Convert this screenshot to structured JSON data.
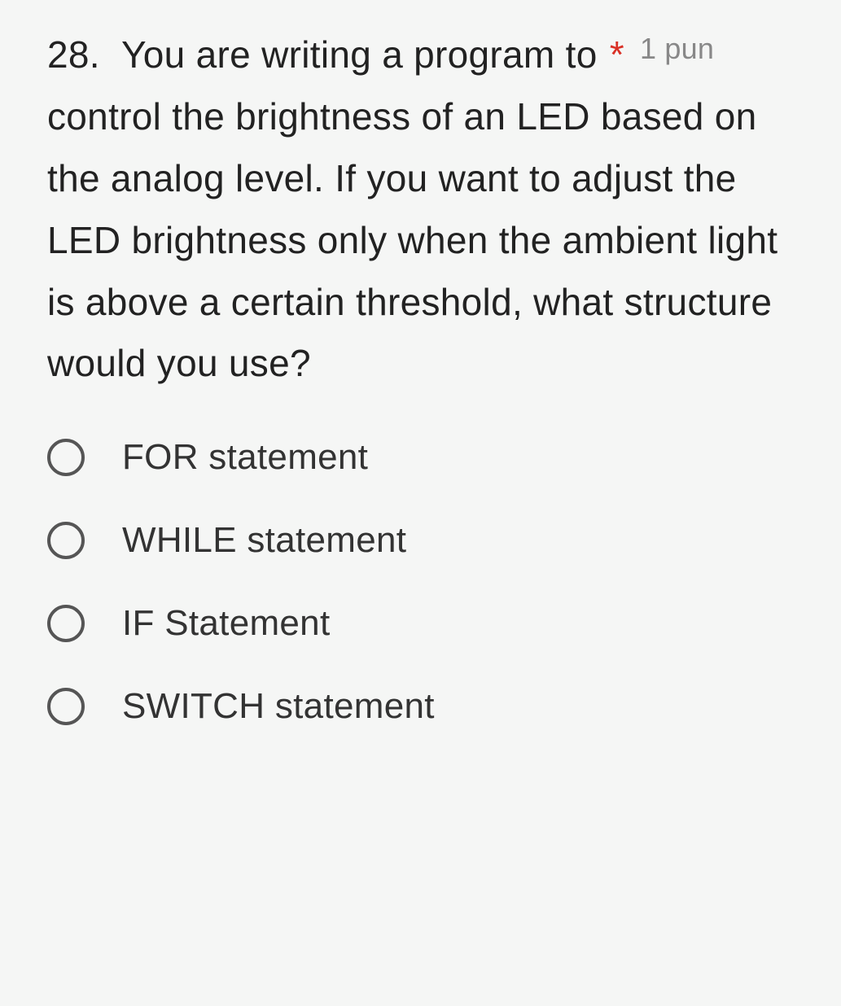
{
  "question": {
    "number": "28.",
    "text_line1": "You are writing a program to",
    "text_rest": "control the brightness of an LED based on the analog level. If you want to adjust the LED brightness only when the ambient light is above a certain threshold, what structure would you use?",
    "required_mark": "*",
    "points_label": "1 pun"
  },
  "options": [
    {
      "label": "FOR statement"
    },
    {
      "label": "WHILE statement"
    },
    {
      "label": "IF Statement"
    },
    {
      "label": "SWITCH statement"
    }
  ]
}
